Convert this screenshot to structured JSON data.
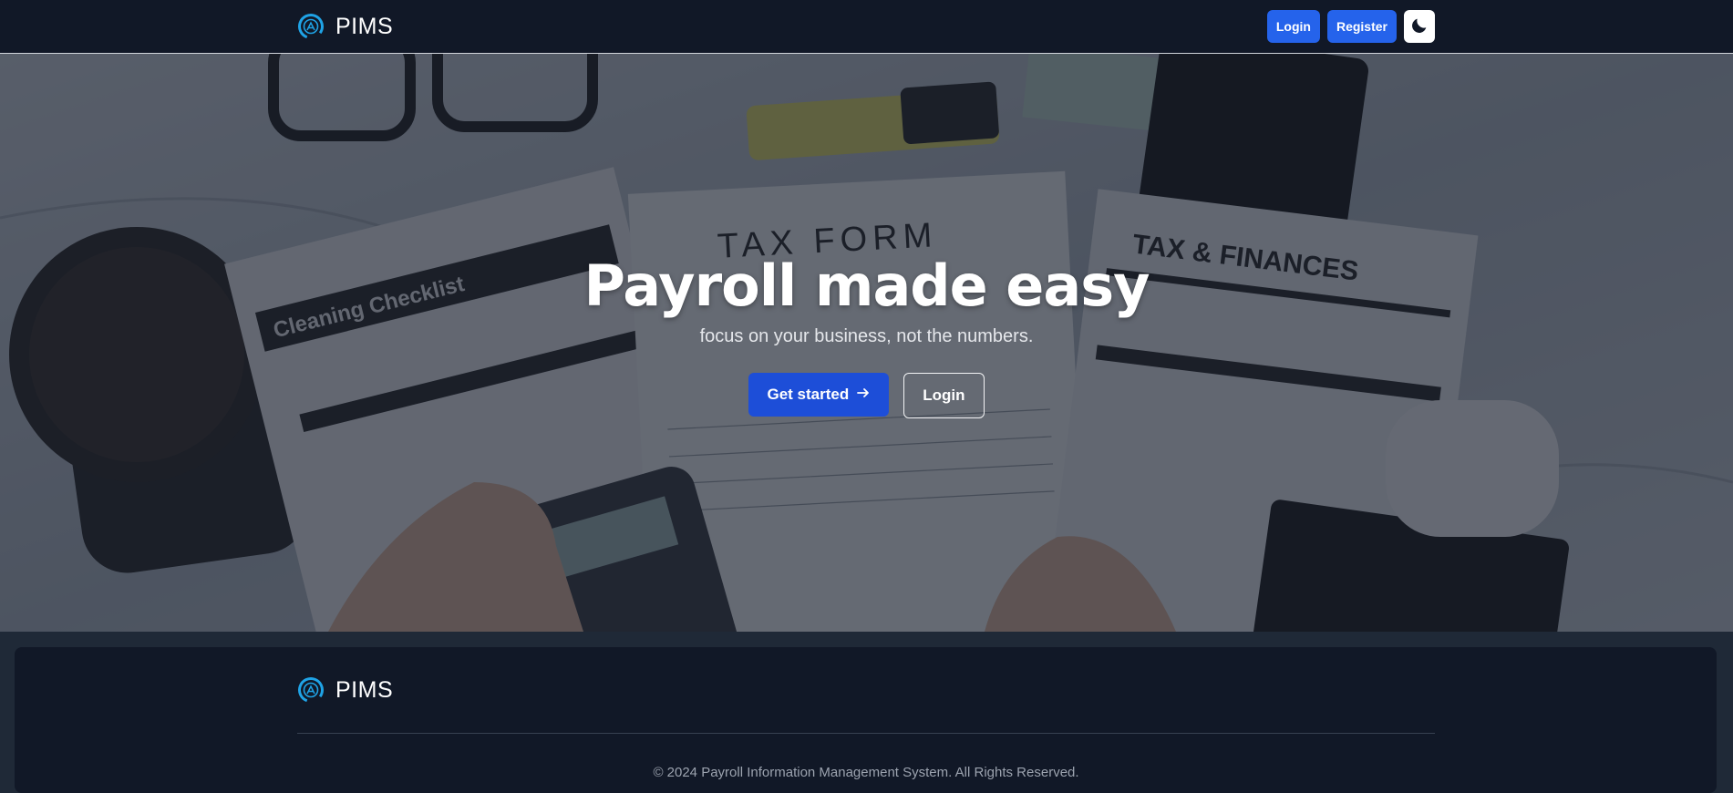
{
  "navbar": {
    "brand": "PIMS",
    "login_label": "Login",
    "register_label": "Register",
    "logo_icon": "pims-logo-icon",
    "theme_icon": "moon-icon"
  },
  "hero": {
    "title": "Payroll made easy",
    "subtitle": "focus on your business, not the numbers.",
    "primary_cta": "Get started",
    "primary_cta_icon": "arrow-right-icon",
    "secondary_cta": "Login"
  },
  "footer": {
    "brand": "PIMS",
    "copyright": "© 2024 Payroll Information Management System. All Rights Reserved."
  },
  "colors": {
    "nav_bg": "#111827",
    "accent": "#2563eb",
    "primary_button": "#1d4ed8",
    "logo": "#1fa3e6"
  }
}
